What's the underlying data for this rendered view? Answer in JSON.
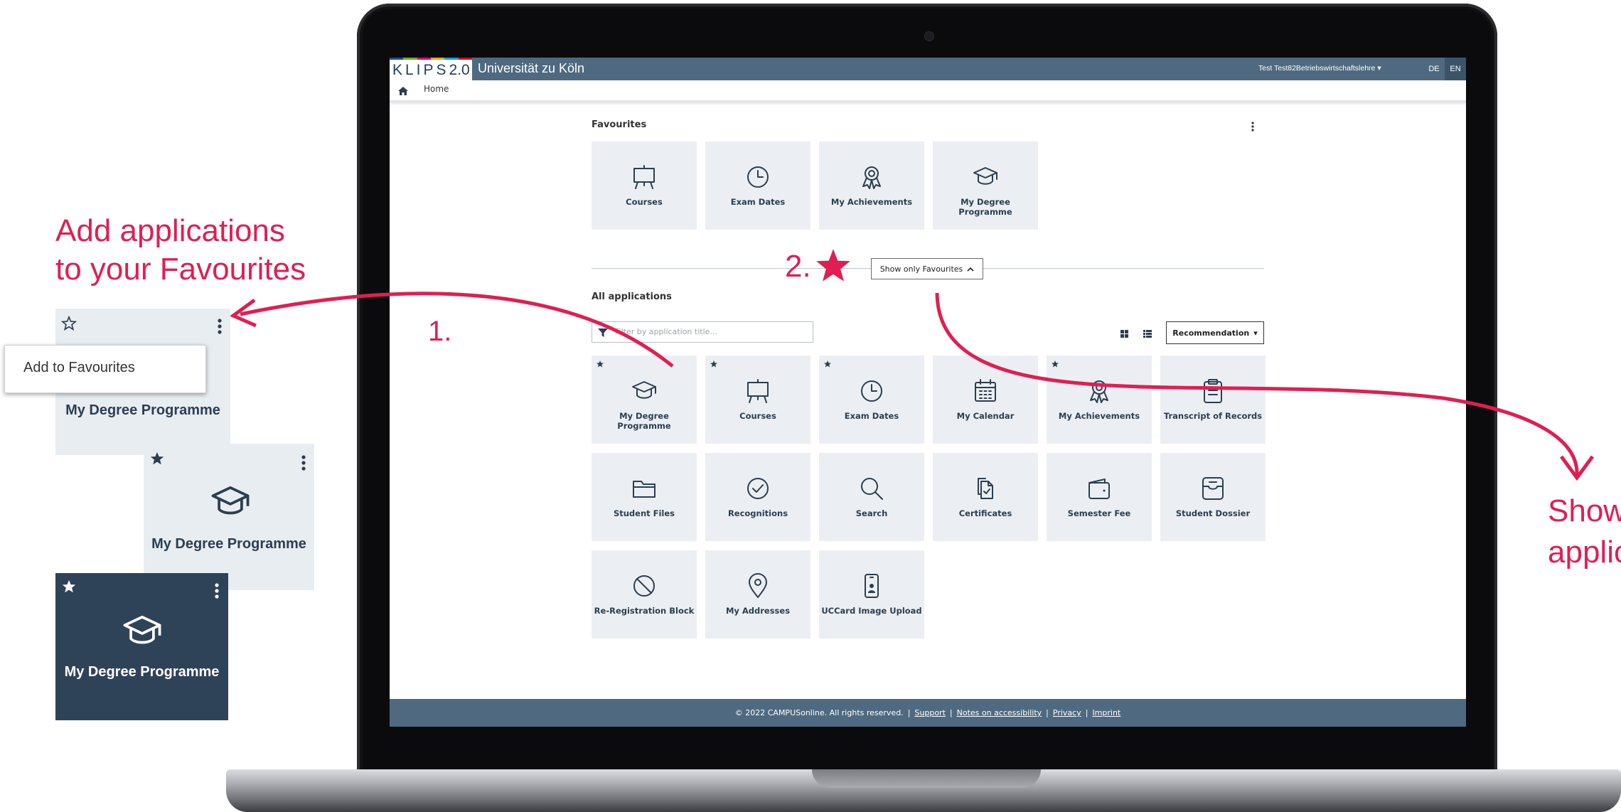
{
  "colors": {
    "accent_annotation": "#e01e52",
    "header_bg": "#4f6a80",
    "tile_bg": "#ebeff3",
    "tile_dark": "#2f4358",
    "text_dark": "#2c3e50"
  },
  "header": {
    "logo_main": "KLIPS",
    "logo_version": "2.0",
    "university": "Universität zu Köln",
    "user": "Test Test82Betriebswirtschaftslehre",
    "lang_de": "DE",
    "lang_en": "EN"
  },
  "breadcrumb": {
    "home": "Home"
  },
  "favourites": {
    "title": "Favourites",
    "tiles": [
      {
        "label": "Courses",
        "icon": "presentation-board-icon"
      },
      {
        "label": "Exam Dates",
        "icon": "clock-icon"
      },
      {
        "label": "My Achievements",
        "icon": "award-ribbon-icon"
      },
      {
        "label": "My Degree Programme",
        "icon": "graduation-cap-icon"
      }
    ]
  },
  "toggle": {
    "label": "Show only Favourites"
  },
  "all_apps": {
    "title": "All applications",
    "filter_placeholder": "Filter by application title...",
    "sort_label": "Recommendation",
    "tiles": [
      {
        "label": "My Degree Programme",
        "icon": "graduation-cap-icon",
        "favourite": true
      },
      {
        "label": "Courses",
        "icon": "presentation-board-icon",
        "favourite": true
      },
      {
        "label": "Exam Dates",
        "icon": "clock-icon",
        "favourite": true
      },
      {
        "label": "My Calendar",
        "icon": "calendar-icon",
        "favourite": false
      },
      {
        "label": "My Achievements",
        "icon": "award-ribbon-icon",
        "favourite": true
      },
      {
        "label": "Transcript of Records",
        "icon": "clipboard-icon",
        "favourite": false
      },
      {
        "label": "Student Files",
        "icon": "folder-icon",
        "favourite": false
      },
      {
        "label": "Recognitions",
        "icon": "check-circle-icon",
        "favourite": false
      },
      {
        "label": "Search",
        "icon": "magnifier-icon",
        "favourite": false
      },
      {
        "label": "Certificates",
        "icon": "documents-icon",
        "favourite": false
      },
      {
        "label": "Semester Fee",
        "icon": "wallet-icon",
        "favourite": false
      },
      {
        "label": "Student Dossier",
        "icon": "inbox-tray-icon",
        "favourite": false
      },
      {
        "label": "Re-Registration Block",
        "icon": "prohibited-icon",
        "favourite": false
      },
      {
        "label": "My Addresses",
        "icon": "map-pin-icon",
        "favourite": false
      },
      {
        "label": "UCCard Image Upload",
        "icon": "phone-id-icon",
        "favourite": false
      }
    ]
  },
  "footer": {
    "copyright": "© 2022 CAMPUSonline. All rights reserved.",
    "sep": "|",
    "support": "Support",
    "accessibility": "Notes on accessibility",
    "privacy": "Privacy",
    "imprint": "Imprint"
  },
  "annotations": {
    "add_line1": "Add applications",
    "add_line2": "to your Favourites",
    "step1": "1.",
    "step2": "2.",
    "show_line1": "Show",
    "show_line2": "applic",
    "menu_item": "Add to Favourites",
    "card_label": "My Degree Programme"
  }
}
